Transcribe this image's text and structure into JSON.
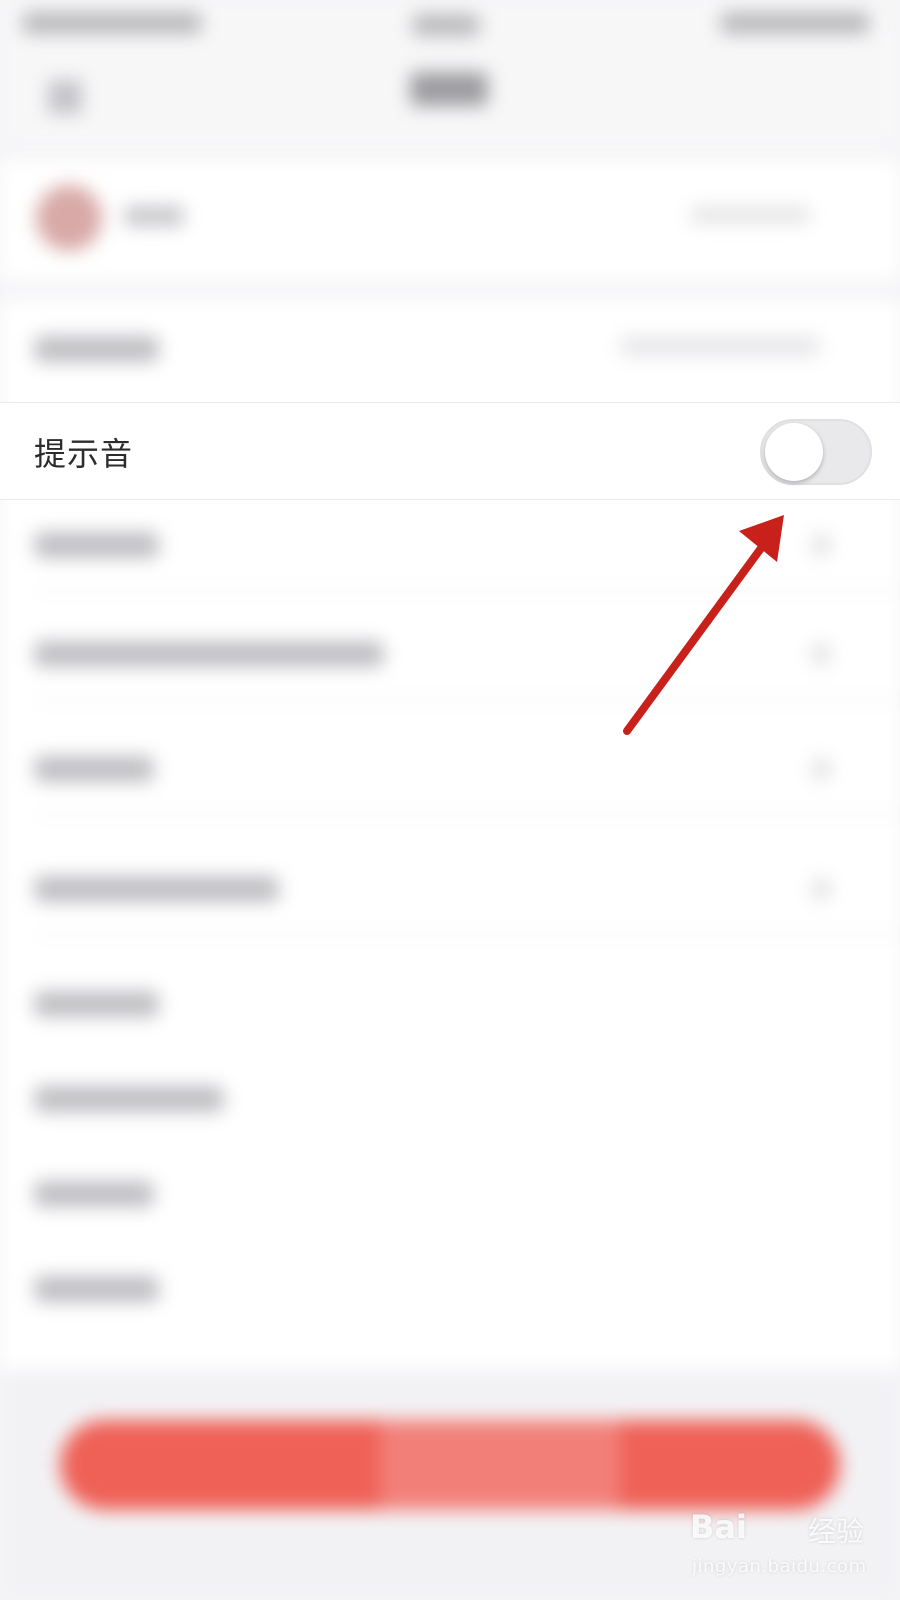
{
  "settings": {
    "sound_row": {
      "label": "提示音",
      "toggle_on": false
    },
    "logout_button_color": "#ef6157"
  },
  "annotation": {
    "arrow_color": "#c8201a"
  },
  "watermark": {
    "brand": "Bai",
    "brand_suffix": "经验",
    "url": "jingyan.baidu.com"
  }
}
